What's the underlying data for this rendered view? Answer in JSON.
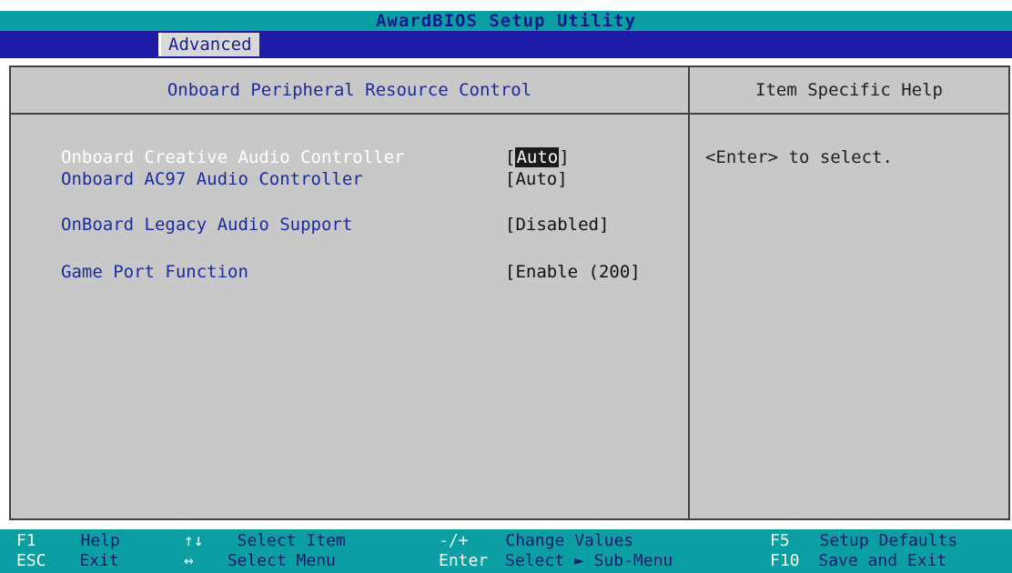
{
  "app": {
    "title": "AwardBIOS Setup Utility"
  },
  "menu": {
    "active_tab": "Advanced"
  },
  "panel": {
    "title": "Onboard Peripheral Resource Control",
    "help_title": "Item Specific Help",
    "help_text": "<Enter> to select.",
    "items": [
      {
        "label": "Onboard Creative Audio Controller",
        "value": "Auto",
        "selected": true
      },
      {
        "label": "Onboard AC97 Audio Controller",
        "value": "[Auto]"
      },
      {
        "label": "OnBoard Legacy Audio Support",
        "value": "[Disabled]"
      },
      {
        "label": "Game Port Function",
        "value": "[Enable (200]"
      }
    ]
  },
  "footer": {
    "keys": [
      {
        "key": "F1",
        "desc": "Help"
      },
      {
        "key": "ESC",
        "desc": "Exit"
      },
      {
        "key": "↑↓",
        "desc": "Select Item"
      },
      {
        "key": "↔",
        "desc": "Select Menu"
      },
      {
        "key": "-/+",
        "desc": "Change Values"
      },
      {
        "key": "Enter",
        "desc": "Select ► Sub-Menu"
      },
      {
        "key": "F5",
        "desc": "Setup Defaults"
      },
      {
        "key": "F10",
        "desc": "Save and Exit"
      }
    ]
  }
}
